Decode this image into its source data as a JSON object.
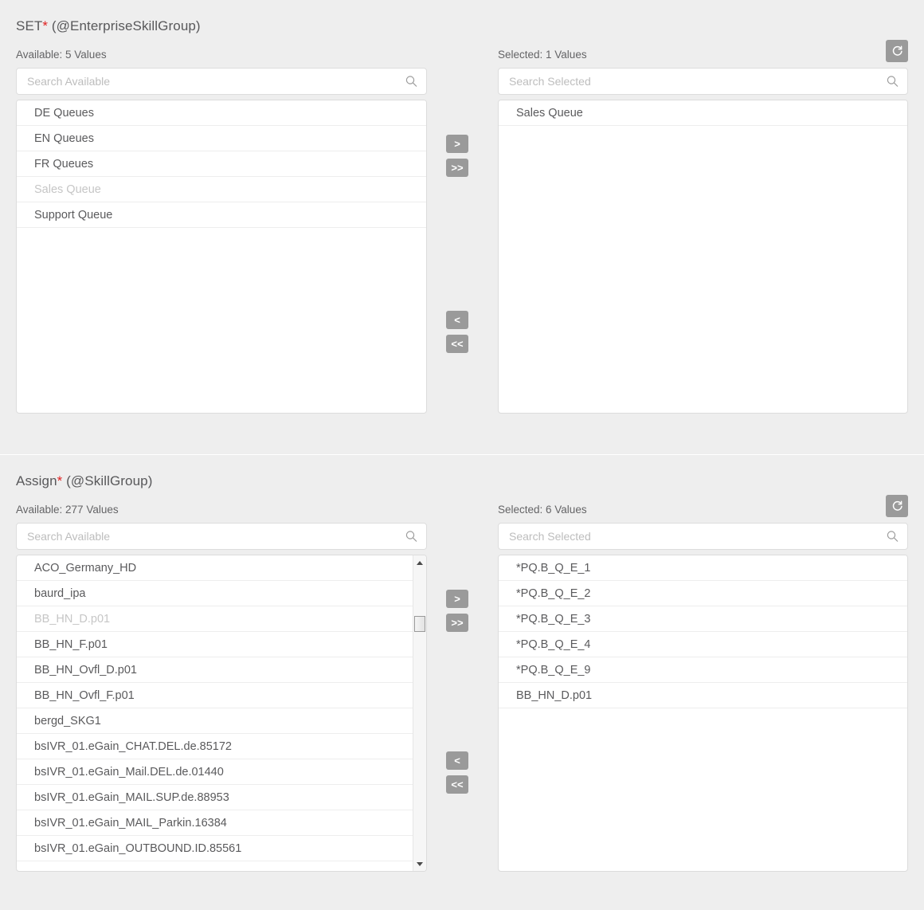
{
  "colors": {
    "background": "#eeeeee",
    "panel": "#ffffff",
    "accent_required": "#e02020",
    "button_grey": "#9a9a9a",
    "text": "#5a5a5c",
    "text_disabled": "#c6c6c6"
  },
  "sections": [
    {
      "id": "set-enterpriseskillgroup",
      "title_main": "SET",
      "title_star": "*",
      "title_suffix": " (@EnterpriseSkillGroup)",
      "available": {
        "label": "Available: 5 Values",
        "search_placeholder": "Search Available",
        "search_value": "",
        "items": [
          {
            "label": "DE Queues",
            "disabled": false
          },
          {
            "label": "EN Queues",
            "disabled": false
          },
          {
            "label": "FR Queues",
            "disabled": false
          },
          {
            "label": "Sales Queue",
            "disabled": true
          },
          {
            "label": "Support Queue",
            "disabled": false
          }
        ],
        "has_scrollbar": false
      },
      "selected": {
        "label": "Selected: 1 Values",
        "search_placeholder": "Search Selected",
        "search_value": "",
        "refresh_icon": "refresh-icon",
        "items": [
          {
            "label": "Sales Queue",
            "disabled": false
          }
        ]
      },
      "transfer": {
        "add_one": ">",
        "add_all": ">>",
        "remove_one": "<",
        "remove_all": "<<"
      }
    },
    {
      "id": "assign-skillgroup",
      "title_main": "Assign",
      "title_star": "*",
      "title_suffix": " (@SkillGroup)",
      "available": {
        "label": "Available: 277 Values",
        "search_placeholder": "Search Available",
        "search_value": "",
        "items": [
          {
            "label": "ACO_Germany_HD",
            "disabled": false
          },
          {
            "label": "baurd_ipa",
            "disabled": false
          },
          {
            "label": "BB_HN_D.p01",
            "disabled": true
          },
          {
            "label": "BB_HN_F.p01",
            "disabled": false
          },
          {
            "label": "BB_HN_Ovfl_D.p01",
            "disabled": false
          },
          {
            "label": "BB_HN_Ovfl_F.p01",
            "disabled": false
          },
          {
            "label": "bergd_SKG1",
            "disabled": false
          },
          {
            "label": "bsIVR_01.eGain_CHAT.DEL.de.85172",
            "disabled": false
          },
          {
            "label": "bsIVR_01.eGain_Mail.DEL.de.01440",
            "disabled": false
          },
          {
            "label": "bsIVR_01.eGain_MAIL.SUP.de.88953",
            "disabled": false
          },
          {
            "label": "bsIVR_01.eGain_MAIL_Parkin.16384",
            "disabled": false
          },
          {
            "label": "bsIVR_01.eGain_OUTBOUND.ID.85561",
            "disabled": false
          }
        ],
        "has_scrollbar": true
      },
      "selected": {
        "label": "Selected: 6 Values",
        "search_placeholder": "Search Selected",
        "search_value": "",
        "refresh_icon": "refresh-icon",
        "items": [
          {
            "label": "*PQ.B_Q_E_1",
            "disabled": false
          },
          {
            "label": "*PQ.B_Q_E_2",
            "disabled": false
          },
          {
            "label": "*PQ.B_Q_E_3",
            "disabled": false
          },
          {
            "label": "*PQ.B_Q_E_4",
            "disabled": false
          },
          {
            "label": "*PQ.B_Q_E_9",
            "disabled": false
          },
          {
            "label": "BB_HN_D.p01",
            "disabled": false
          }
        ]
      },
      "transfer": {
        "add_one": ">",
        "add_all": ">>",
        "remove_one": "<",
        "remove_all": "<<"
      }
    }
  ]
}
